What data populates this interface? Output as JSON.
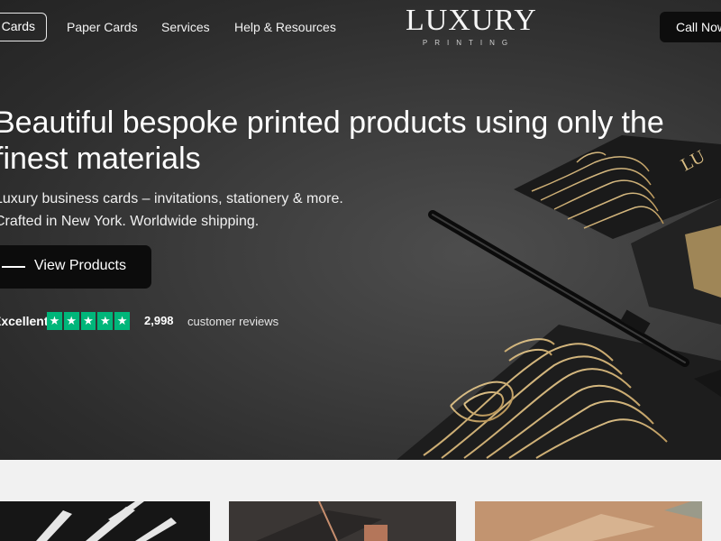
{
  "nav": {
    "active_item": "Cards",
    "links": [
      "Paper Cards",
      "Services",
      "Help & Resources"
    ],
    "call_button": "Call Now"
  },
  "logo": {
    "name": "LUXURY",
    "tagline": "PRINTING"
  },
  "hero": {
    "headline": "Beautiful bespoke printed products using only the finest materials",
    "subtext_line1": "Luxury business cards – invitations, stationery & more.",
    "subtext_line2": "Crafted in New York. Worldwide shipping.",
    "cta_label": "View Products",
    "rating": {
      "label": "Excellent",
      "stars": 5,
      "review_count": "2,998",
      "review_label": "customer reviews"
    }
  },
  "colors": {
    "hero_bg": "#3a3a3a",
    "gold_accent": "#c9a86a",
    "trustpilot_green": "#00b67a",
    "button_bg": "#0c0c0c"
  }
}
